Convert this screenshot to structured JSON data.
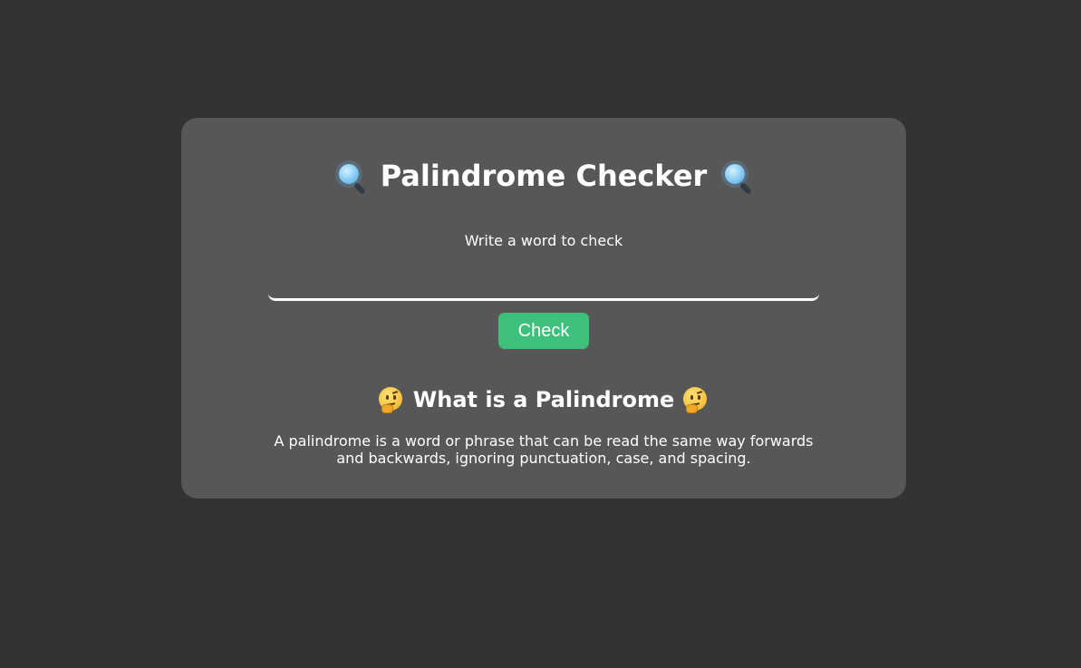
{
  "header": {
    "title": "Palindrome Checker",
    "left_icon": "magnifier-icon",
    "right_icon": "magnifier-icon"
  },
  "form": {
    "label": "Write a word to check",
    "input_value": "",
    "input_placeholder": "",
    "button_label": "Check"
  },
  "info": {
    "heading": "What is a Palindrome",
    "left_icon": "thinking-face-icon",
    "right_icon": "thinking-face-icon",
    "description": "A palindrome is a word or phrase that can be read the same way forwards and backwards, ignoring punctuation, case, and spacing."
  },
  "colors": {
    "background": "#333333",
    "card": "#575757",
    "button": "#3cc07c",
    "text": "#ffffff"
  }
}
